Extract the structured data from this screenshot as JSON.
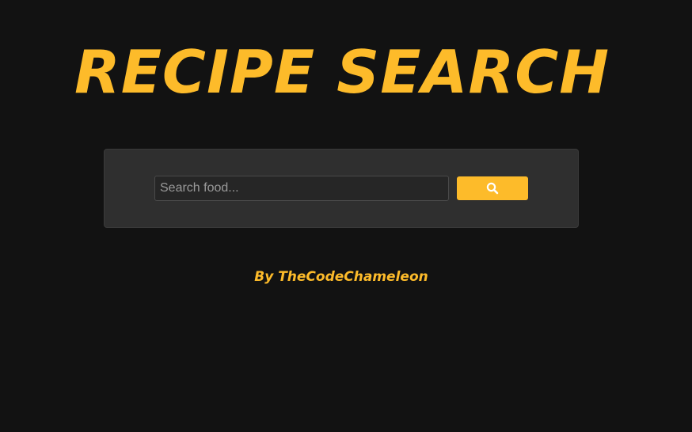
{
  "header": {
    "title": "RECIPE SEARCH"
  },
  "search": {
    "placeholder": "Search food...",
    "value": "",
    "button_icon": "search-icon"
  },
  "footer": {
    "byline": "By TheCodeChameleon"
  },
  "colors": {
    "background": "#121212",
    "panel": "#2f2f2f",
    "accent": "#fdbb2a"
  }
}
